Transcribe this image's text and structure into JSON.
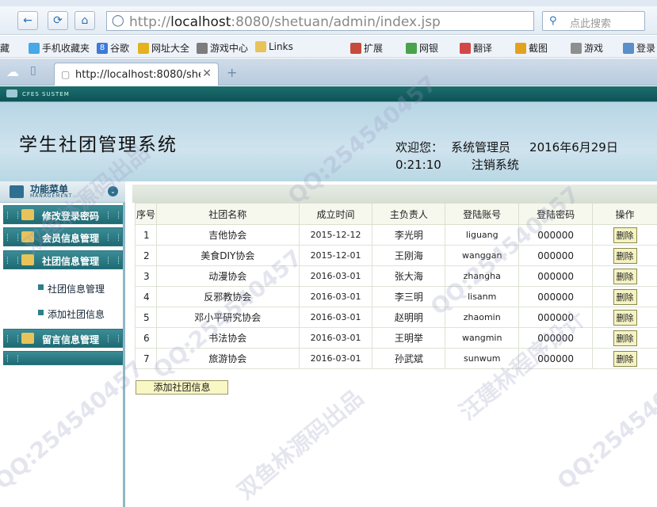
{
  "browser": {
    "url_host": "localhost",
    "url_rest": ":8080/shetuan/admin/index.jsp",
    "url_prefix": "http://",
    "search_placeholder": "点此搜索",
    "tab_title": "http://localhost:8080/shetua",
    "bookmarks": [
      "藏",
      "手机收藏夹",
      "谷歌",
      "网址大全",
      "游戏中心",
      "Links",
      "扩展",
      "网银",
      "翻译",
      "截图",
      "游戏",
      "登录"
    ]
  },
  "app": {
    "banner": "CFES SUSTEM",
    "system_title": "学生社团管理系统",
    "welcome_label": "欢迎您：",
    "user_role": "系统管理员",
    "date": "2016年6月29日",
    "time": "0:21:10",
    "logout": "注销系统"
  },
  "sidebar": {
    "title": "功能菜单",
    "subtitle": "MANAGEMENT",
    "items": [
      {
        "label": "修改登录密码"
      },
      {
        "label": "会员信息管理"
      },
      {
        "label": "社团信息管理"
      }
    ],
    "subitems": [
      {
        "label": "社团信息管理"
      },
      {
        "label": "添加社团信息"
      }
    ],
    "bottom_item": {
      "label": "留言信息管理"
    }
  },
  "table": {
    "headers": [
      "序号",
      "社团名称",
      "成立时间",
      "主负责人",
      "登陆账号",
      "登陆密码",
      "操作"
    ],
    "rows": [
      [
        "1",
        "吉他协会",
        "2015-12-12",
        "李光明",
        "liguang",
        "000000",
        "删除"
      ],
      [
        "2",
        "美食DIY协会",
        "2015-12-01",
        "王刚海",
        "wanggan",
        "000000",
        "删除"
      ],
      [
        "3",
        "动漫协会",
        "2016-03-01",
        "张大海",
        "zhangha",
        "000000",
        "删除"
      ],
      [
        "4",
        "反邪教协会",
        "2016-03-01",
        "李三明",
        "lisanm",
        "000000",
        "删除"
      ],
      [
        "5",
        "邓小平研究协会",
        "2016-03-01",
        "赵明明",
        "zhaomin",
        "000000",
        "删除"
      ],
      [
        "6",
        "书法协会",
        "2016-03-01",
        "王明举",
        "wangmin",
        "000000",
        "删除"
      ],
      [
        "7",
        "旅游协会",
        "2016-03-01",
        "孙武斌",
        "sunwum",
        "000000",
        "删除"
      ]
    ]
  },
  "add_button": "添加社团信息",
  "watermarks": [
    "双鱼林源码出品",
    "QQ:254540457",
    "汪建林程序设计"
  ]
}
